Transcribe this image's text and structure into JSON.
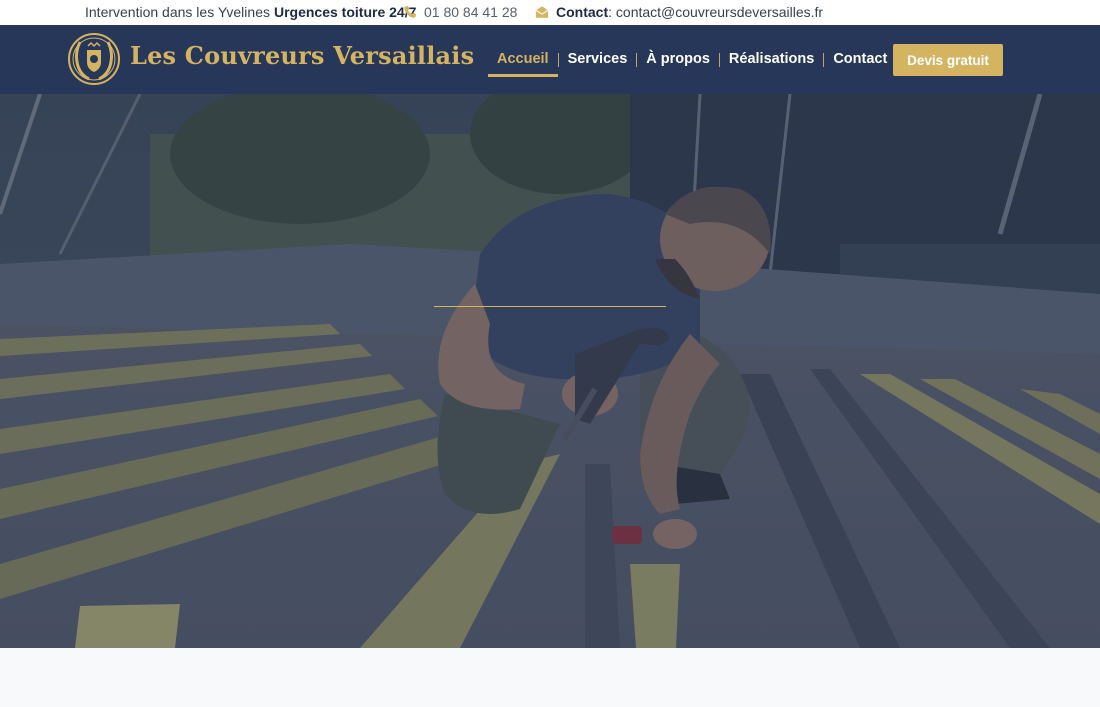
{
  "topbar": {
    "intervention_text": "Intervention dans les Yvelines",
    "urgent_text": "Urgences toiture 24/7",
    "phone_icon": "phone-icon",
    "phone": "01 80 84 41 28",
    "mail_icon": "envelope-icon",
    "contact_label": "Contact",
    "contact_value": ": contact@couvreursdeversailles.fr"
  },
  "header": {
    "logo_icon": "crest-logo-icon",
    "brand": "Les Couvreurs Versaillais",
    "menu": [
      {
        "label": "Accueil",
        "active": true
      },
      {
        "label": "Services",
        "active": false
      },
      {
        "label": "À propos",
        "active": false
      },
      {
        "label": "Réalisations",
        "active": false
      },
      {
        "label": "Contact",
        "active": false
      }
    ],
    "cta_label": "Devis gratuit"
  },
  "hero": {
    "image_subject": "roofer-hammering-on-roof-battens"
  },
  "colors": {
    "navy": "#27375a",
    "gold": "#d4b361",
    "white": "#ffffff",
    "page_bg": "#f7f9fb"
  }
}
